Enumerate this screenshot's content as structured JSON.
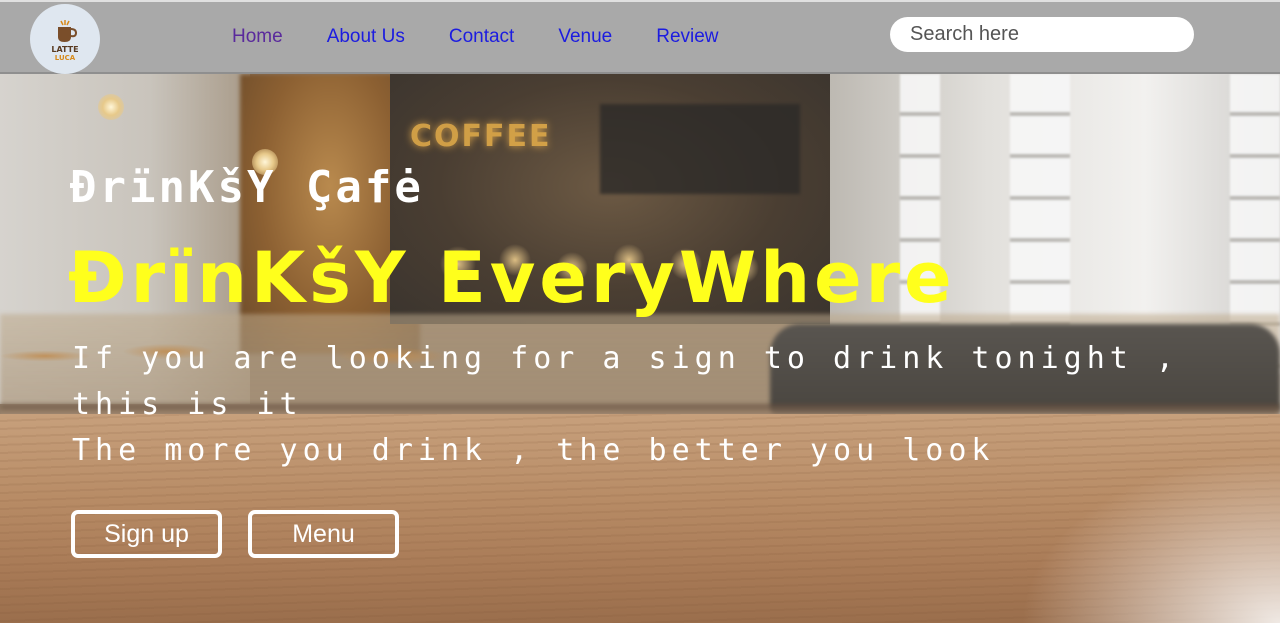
{
  "logo": {
    "line1": "LATTE",
    "line2": "LUCA"
  },
  "nav": {
    "items": [
      {
        "label": "Home"
      },
      {
        "label": "About Us"
      },
      {
        "label": "Contact"
      },
      {
        "label": "Venue"
      },
      {
        "label": "Review"
      }
    ]
  },
  "search": {
    "placeholder": "Search here",
    "value": ""
  },
  "background": {
    "sign_text": "COFFEE"
  },
  "hero": {
    "cafe_name": "ĐrïnKšY Çafė",
    "tagline": "ĐrïnKšY EveryWhere",
    "line1": "If you are looking for a sign to drink tonight , this is it",
    "line2": "The more you drink , the better you look",
    "signup_label": "Sign up",
    "menu_label": "Menu"
  },
  "colors": {
    "navbar_bg": "#a9a9a9",
    "link": "#1c1ce0",
    "link_visited": "#5a2a9c",
    "tagline": "#ffff1c",
    "text": "#ffffff"
  }
}
